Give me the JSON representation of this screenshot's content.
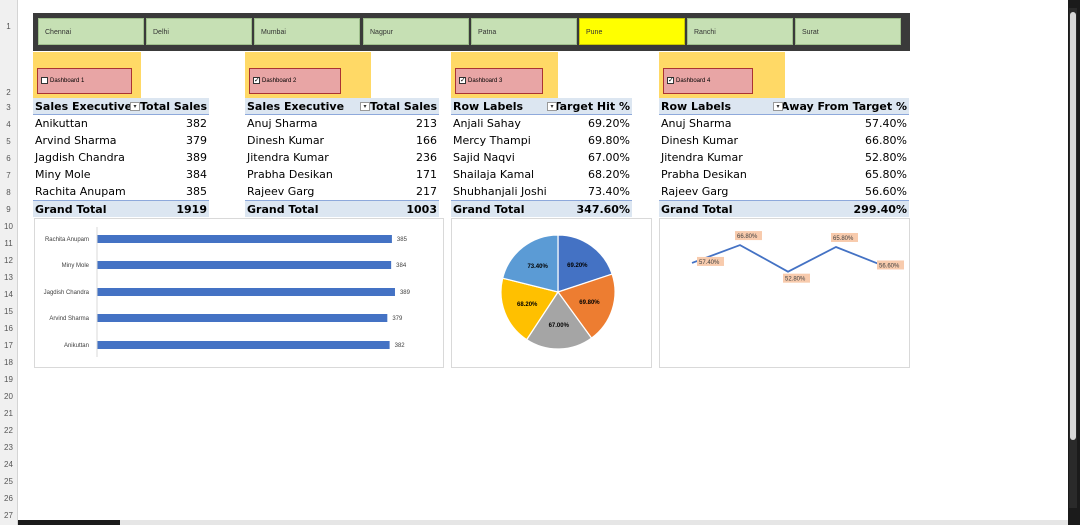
{
  "row_numbers": [
    "1",
    "2",
    "3",
    "4",
    "5",
    "6",
    "7",
    "8",
    "9",
    "10",
    "11",
    "12",
    "13",
    "14",
    "15",
    "16",
    "17",
    "18",
    "19",
    "20",
    "21",
    "22",
    "23",
    "24",
    "25",
    "26",
    "27"
  ],
  "slicer": {
    "cities": [
      "Chennai",
      "Delhi",
      "Mumbai",
      "Nagpur",
      "Patna",
      "Pune",
      "Ranchi",
      "Surat"
    ],
    "selected": "Pune",
    "selected_color": "#ffff00",
    "item_color": "#c6e0b4"
  },
  "dashboards": [
    {
      "label": "Dashboard 1",
      "checked": false
    },
    {
      "label": "Dashboard 2",
      "checked": true
    },
    {
      "label": "Dashboard 3",
      "checked": true
    },
    {
      "label": "Dashboard 4",
      "checked": true
    }
  ],
  "pivots": [
    {
      "header": [
        "Sales Executive",
        "Total Sales"
      ],
      "rows": [
        [
          "Anikuttan",
          "382"
        ],
        [
          "Arvind Sharma",
          "379"
        ],
        [
          "Jagdish Chandra",
          "389"
        ],
        [
          "Miny Mole",
          "384"
        ],
        [
          "Rachita Anupam",
          "385"
        ]
      ],
      "total": [
        "Grand Total",
        "1919"
      ]
    },
    {
      "header": [
        "Sales Executive",
        "Total Sales"
      ],
      "rows": [
        [
          "Anuj Sharma",
          "213"
        ],
        [
          "Dinesh Kumar",
          "166"
        ],
        [
          "Jitendra Kumar",
          "236"
        ],
        [
          "Prabha Desikan",
          "171"
        ],
        [
          "Rajeev Garg",
          "217"
        ]
      ],
      "total": [
        "Grand Total",
        "1003"
      ]
    },
    {
      "header": [
        "Row Labels",
        "Target Hit %"
      ],
      "rows": [
        [
          "Anjali Sahay",
          "69.20%"
        ],
        [
          "Mercy Thampi",
          "69.80%"
        ],
        [
          "Sajid Naqvi",
          "67.00%"
        ],
        [
          "Shailaja Kamal",
          "68.20%"
        ],
        [
          "Shubhanjali Joshi",
          "73.40%"
        ]
      ],
      "total": [
        "Grand Total",
        "347.60%"
      ]
    },
    {
      "header": [
        "Row Labels",
        "Away From Target %"
      ],
      "rows": [
        [
          "Anuj Sharma",
          "57.40%"
        ],
        [
          "Dinesh Kumar",
          "66.80%"
        ],
        [
          "Jitendra Kumar",
          "52.80%"
        ],
        [
          "Prabha Desikan",
          "65.80%"
        ],
        [
          "Rajeev Garg",
          "56.60%"
        ]
      ],
      "total": [
        "Grand Total",
        "299.40%"
      ]
    }
  ],
  "chart_data": [
    {
      "type": "bar",
      "orientation": "horizontal",
      "categories": [
        "Rachita Anupam",
        "Miny Mole",
        "Jagdish Chandra",
        "Arvind Sharma",
        "Anikuttan"
      ],
      "values": [
        385,
        384,
        389,
        379,
        382
      ],
      "value_labels": [
        "385",
        "384",
        "389",
        "379",
        "382"
      ],
      "color": "#4472c4"
    },
    {
      "type": "pie",
      "values": [
        69.2,
        69.8,
        67.0,
        68.2,
        73.4
      ],
      "value_labels": [
        "69.20%",
        "69.80%",
        "67.00%",
        "68.20%",
        "73.40%"
      ],
      "colors": [
        "#4472c4",
        "#ed7d31",
        "#a5a5a5",
        "#ffc000",
        "#5b9bd5"
      ]
    },
    {
      "type": "line",
      "values": [
        57.4,
        66.8,
        52.8,
        65.8,
        56.6
      ],
      "value_labels": [
        "57.40%",
        "66.80%",
        "52.80%",
        "65.80%",
        "56.60%"
      ],
      "color": "#4472c4",
      "label_bg": "#f8cbad"
    }
  ]
}
